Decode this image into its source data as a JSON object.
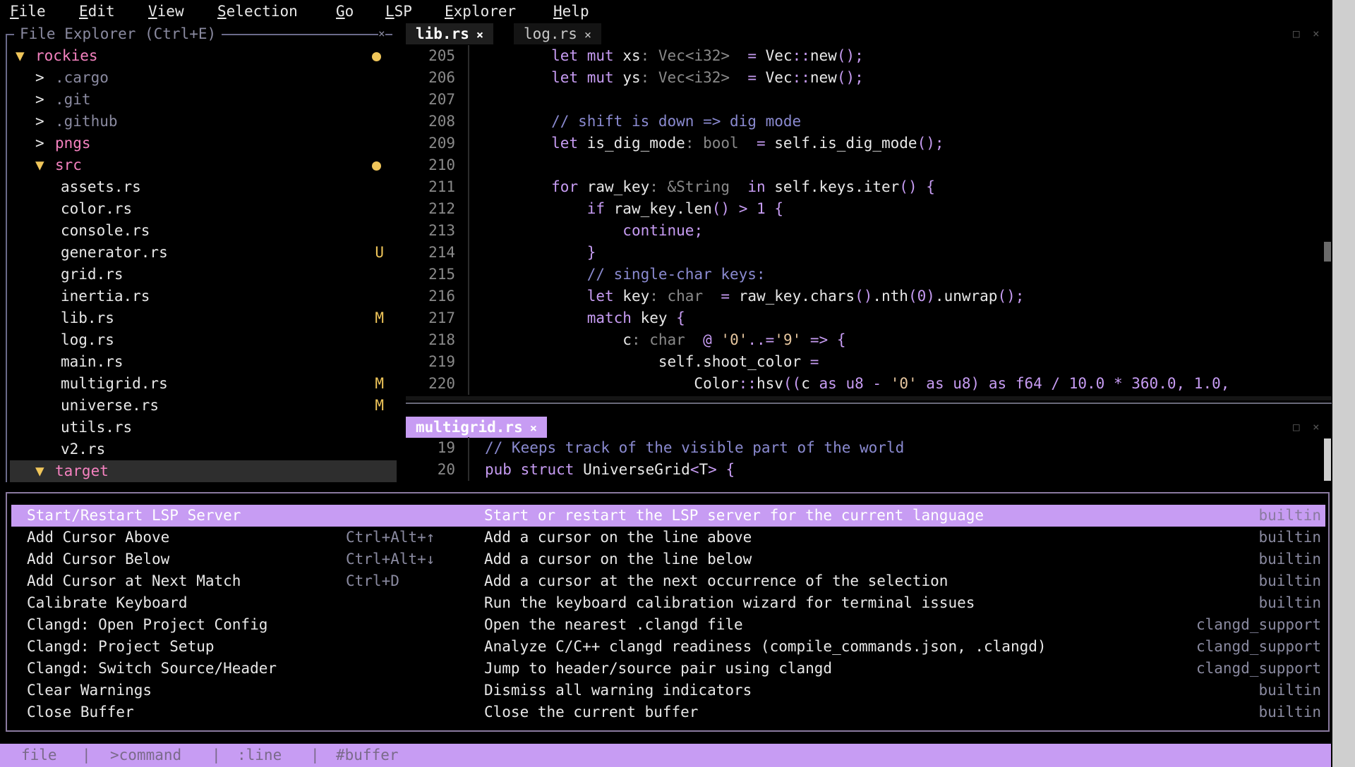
{
  "menu": [
    "File",
    "Edit",
    "View",
    "Selection",
    "Go",
    "LSP",
    "Explorer",
    "Help"
  ],
  "explorer": {
    "title": "File Explorer (Ctrl+E)",
    "close": "×",
    "items": [
      {
        "arrow": "▼",
        "label": "rockies",
        "color": "#f582c0",
        "badge": "",
        "dot": true
      },
      {
        "arrow": ">",
        "label": ".cargo",
        "color": "#8a8aa0",
        "badge": "",
        "dot": false
      },
      {
        "arrow": ">",
        "label": ".git",
        "color": "#8a8aa0",
        "badge": "",
        "dot": false
      },
      {
        "arrow": ">",
        "label": ".github",
        "color": "#8a8aa0",
        "badge": "",
        "dot": false
      },
      {
        "arrow": ">",
        "label": "pngs",
        "color": "#f582c0",
        "badge": "",
        "dot": false
      },
      {
        "arrow": "▼",
        "label": "src",
        "color": "#f582c0",
        "badge": "",
        "dot": true
      },
      {
        "arrow": "",
        "label": "assets.rs",
        "color": "#e8e8e8",
        "badge": "",
        "dot": false
      },
      {
        "arrow": "",
        "label": "color.rs",
        "color": "#e8e8e8",
        "badge": "",
        "dot": false
      },
      {
        "arrow": "",
        "label": "console.rs",
        "color": "#e8e8e8",
        "badge": "",
        "dot": false
      },
      {
        "arrow": "",
        "label": "generator.rs",
        "color": "#e8e8e8",
        "badge": "U",
        "dot": false
      },
      {
        "arrow": "",
        "label": "grid.rs",
        "color": "#e8e8e8",
        "badge": "",
        "dot": false
      },
      {
        "arrow": "",
        "label": "inertia.rs",
        "color": "#e8e8e8",
        "badge": "",
        "dot": false
      },
      {
        "arrow": "",
        "label": "lib.rs",
        "color": "#e8e8e8",
        "badge": "M",
        "dot": false
      },
      {
        "arrow": "",
        "label": "log.rs",
        "color": "#e8e8e8",
        "badge": "",
        "dot": false
      },
      {
        "arrow": "",
        "label": "main.rs",
        "color": "#e8e8e8",
        "badge": "",
        "dot": false
      },
      {
        "arrow": "",
        "label": "multigrid.rs",
        "color": "#e8e8e8",
        "badge": "M",
        "dot": false
      },
      {
        "arrow": "",
        "label": "universe.rs",
        "color": "#e8e8e8",
        "badge": "M",
        "dot": false
      },
      {
        "arrow": "",
        "label": "utils.rs",
        "color": "#e8e8e8",
        "badge": "",
        "dot": false
      },
      {
        "arrow": "",
        "label": "v2.rs",
        "color": "#e8e8e8",
        "badge": "",
        "dot": false
      },
      {
        "arrow": "▼",
        "label": "target",
        "color": "#f582c0",
        "badge": "",
        "dot": false
      }
    ]
  },
  "tabs_top": [
    {
      "label": "lib.rs",
      "close": "×"
    },
    {
      "label": "log.rs",
      "close": "×"
    }
  ],
  "tabs_bottom": [
    {
      "label": "multigrid.rs",
      "close": "×"
    }
  ],
  "window_controls": {
    "maximize": "□",
    "close": "×"
  },
  "editor1": {
    "lines": [
      {
        "n": "205",
        "html": "        <span class='kw'>let</span> <span class='kw'>mut</span> xs<span class='ty'>: Vec&lt;i32&gt; </span> <span class='pu'>=</span> Vec<span class='pu'>::</span>new<span class='pu'>();</span>"
      },
      {
        "n": "206",
        "html": "        <span class='kw'>let</span> <span class='kw'>mut</span> ys<span class='ty'>: Vec&lt;i32&gt; </span> <span class='pu'>=</span> Vec<span class='pu'>::</span>new<span class='pu'>();</span>"
      },
      {
        "n": "207",
        "html": ""
      },
      {
        "n": "208",
        "html": "        <span class='cm'>// shift is down =&gt; dig mode</span>"
      },
      {
        "n": "209",
        "html": "        <span class='kw'>let</span> is_dig_mode<span class='ty'>: bool </span> <span class='pu'>=</span> self.is_dig_mode<span class='pu'>();</span>"
      },
      {
        "n": "210",
        "html": ""
      },
      {
        "n": "211",
        "html": "        <span class='kw'>for</span> raw_key<span class='ty'>: &amp;String </span> <span class='kw'>in</span> self.keys.iter<span class='pu'>()</span> <span class='pu'>{</span>"
      },
      {
        "n": "212",
        "html": "            <span class='kw'>if</span> raw_key.len<span class='pu'>()</span> <span class='pu'>&gt;</span> <span class='nu'>1</span> <span class='pu'>{</span>"
      },
      {
        "n": "213",
        "html": "                <span class='kw'>continue;</span>"
      },
      {
        "n": "214",
        "html": "            <span class='pu'>}</span>"
      },
      {
        "n": "215",
        "html": "            <span class='cm'>// single-char keys:</span>"
      },
      {
        "n": "216",
        "html": "            <span class='kw'>let</span> key<span class='ty'>: char </span> <span class='pu'>=</span> raw_key.chars<span class='pu'>()</span>.nth<span class='pu'>(</span><span class='nu'>0</span><span class='pu'>)</span>.unwrap<span class='pu'>();</span>"
      },
      {
        "n": "217",
        "html": "            <span class='kw'>match</span> key <span class='pu'>{</span>"
      },
      {
        "n": "218",
        "html": "                c<span class='ty'>: char </span> <span class='pu'>@</span> <span class='st'>'0'</span><span class='pu'>..=</span><span class='st'>'9'</span> <span class='pu'>=&gt;</span> <span class='pu'>{</span>"
      },
      {
        "n": "219",
        "html": "                    self.shoot_color <span class='pu'>=</span>"
      },
      {
        "n": "220",
        "html": "                        Color<span class='pu'>::</span>hsv<span class='pu'>((</span>c <span class='kw'>as</span> <span class='nu'>u8</span> <span class='pu'>-</span> <span class='st'>'0'</span> <span class='kw'>as</span> <span class='nu'>u8</span><span class='pu'>)</span> <span class='kw'>as</span> <span class='nu'>f64</span> <span class='pu'>/</span> <span class='nu'>10.0</span> <span class='pu'>*</span> <span class='nu'>360.0</span><span class='pu'>,</span> <span class='nu'>1.0</span><span class='pu'>,</span>"
      }
    ]
  },
  "editor2": {
    "lines": [
      {
        "n": "19",
        "html": "<span class='cm'>// Keeps track of the visible part of the world</span>"
      },
      {
        "n": "20",
        "html": "<span class='kw'>pub</span> <span class='kw'>struct</span> UniverseGrid<span class='pu'>&lt;</span>T<span class='pu'>&gt;</span> <span class='pu'>{</span>"
      }
    ]
  },
  "palette": {
    "selected_index": 0,
    "items": [
      {
        "name": "Start/Restart LSP Server",
        "key": "",
        "desc": "Start or restart the LSP server for the current language",
        "src": "builtin"
      },
      {
        "name": "Add Cursor Above",
        "key": "Ctrl+Alt+↑",
        "desc": "Add a cursor on the line above",
        "src": "builtin"
      },
      {
        "name": "Add Cursor Below",
        "key": "Ctrl+Alt+↓",
        "desc": "Add a cursor on the line below",
        "src": "builtin"
      },
      {
        "name": "Add Cursor at Next Match",
        "key": "Ctrl+D",
        "desc": "Add a cursor at the next occurrence of the selection",
        "src": "builtin"
      },
      {
        "name": "Calibrate Keyboard",
        "key": "",
        "desc": "Run the keyboard calibration wizard for terminal issues",
        "src": "builtin"
      },
      {
        "name": "Clangd: Open Project Config",
        "key": "",
        "desc": "Open the nearest .clangd file",
        "src": "clangd_support"
      },
      {
        "name": "Clangd: Project Setup",
        "key": "",
        "desc": "Analyze C/C++ clangd readiness (compile_commands.json, .clangd)",
        "src": "clangd_support"
      },
      {
        "name": "Clangd: Switch Source/Header",
        "key": "",
        "desc": "Jump to header/source pair using clangd",
        "src": "clangd_support"
      },
      {
        "name": "Clear Warnings",
        "key": "",
        "desc": "Dismiss all warning indicators",
        "src": "builtin"
      },
      {
        "name": "Close Buffer",
        "key": "",
        "desc": "Close the current buffer",
        "src": "builtin"
      }
    ]
  },
  "bottom_hints": [
    "file",
    "|",
    ">command",
    "|",
    ":line",
    "|",
    "#buffer"
  ],
  "colors": {
    "accent": "#c79cf3",
    "badge": "#f0c65a",
    "folder": "#f582c0"
  }
}
